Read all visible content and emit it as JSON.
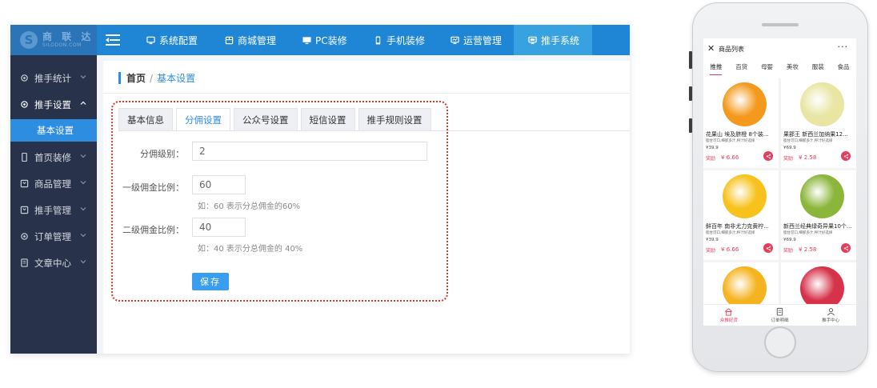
{
  "logo": {
    "mark": "S",
    "name": "商 联 达",
    "sub": "SILODON.COM"
  },
  "topnav": [
    {
      "label": "系统配置",
      "icon": "screen-icon"
    },
    {
      "label": "商城管理",
      "icon": "store-icon"
    },
    {
      "label": "PC装修",
      "icon": "monitor-icon"
    },
    {
      "label": "手机装修",
      "icon": "phone-icon"
    },
    {
      "label": "运营管理",
      "icon": "chart-icon"
    },
    {
      "label": "推手系统",
      "icon": "promoter-icon",
      "active": true
    }
  ],
  "sidebar": {
    "items": [
      {
        "label": "推手统计",
        "icon": "gear-icon"
      },
      {
        "label": "推手设置",
        "icon": "gear-icon",
        "open": true
      },
      {
        "label": "首页装修",
        "icon": "phone-icon"
      },
      {
        "label": "商品管理",
        "icon": "box-icon"
      },
      {
        "label": "推手管理",
        "icon": "box-icon"
      },
      {
        "label": "订单管理",
        "icon": "gear-icon"
      },
      {
        "label": "文章中心",
        "icon": "doc-icon"
      }
    ],
    "sub_active": "基本设置"
  },
  "breadcrumb": {
    "home": "首页",
    "sep": "/",
    "current": "基本设置"
  },
  "tabs": [
    "基本信息",
    "分佣设置",
    "公众号设置",
    "短信设置",
    "推手规则设置"
  ],
  "active_tab": "分佣设置",
  "form": {
    "level_label": "分佣级别：",
    "level_value": "2",
    "first_label": "一级佣金比例：",
    "first_value": "60",
    "first_hint": "如：60 表示分总佣金的60%",
    "second_label": "二级佣金比例：",
    "second_value": "40",
    "second_hint": "如：40 表示分总佣金的 40%",
    "save_label": "保存"
  },
  "phone": {
    "title": "商品列表",
    "close": "✕",
    "more": "···",
    "categories": [
      "推推",
      "百货",
      "母婴",
      "美妆",
      "服装",
      "食品"
    ],
    "products": [
      {
        "name": "花果山 埃及脐橙 8个装...",
        "desc": "脂甘可口,细腻多汁,榨汁好选择",
        "price": "¥39.9",
        "reward_label": "奖励",
        "reward": "¥ 6.66",
        "color": "#f39a1e"
      },
      {
        "name": "果郡王 新西兰加纳果12...",
        "desc": "脂甘可口,细腻多汁,榨汁好选择",
        "price": "¥69.9",
        "reward_label": "奖励",
        "reward": "¥ 2.58",
        "color": "#e8e6a2"
      },
      {
        "name": "鲜百年 南非尤力克黄柠...",
        "desc": "脂甘可口,细腻多汁,榨汁好选择",
        "price": "¥39.9",
        "reward_label": "奖励",
        "reward": "¥ 6.66",
        "color": "#f7c21c"
      },
      {
        "name": "新西兰经典绿奇异果10个...",
        "desc": "脂甘可口,细腻多汁,榨汁好选择",
        "price": "¥69.9",
        "reward_label": "奖励",
        "reward": "¥ 2.58",
        "color": "#8bb63a"
      },
      {
        "color": "#f5b31f"
      },
      {
        "color": "#d6334a"
      }
    ],
    "tabbar": [
      {
        "label": "众推好货",
        "active": true
      },
      {
        "label": "订单明细"
      },
      {
        "label": "推手中心"
      }
    ]
  }
}
